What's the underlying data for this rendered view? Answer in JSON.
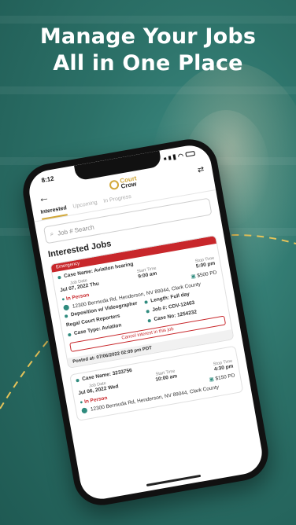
{
  "headline": {
    "line1": "Manage Your Jobs",
    "line2": "All in One Place"
  },
  "phone": {
    "time": "8:12",
    "logo_top": "Court",
    "logo_bottom": "Crow",
    "tabs": [
      {
        "label": "Interested",
        "active": true
      },
      {
        "label": "Upcoming",
        "active": false
      },
      {
        "label": "In Progress",
        "active": false
      }
    ],
    "search_placeholder": "Job # Search",
    "section_title": "Interested Jobs",
    "jobs": [
      {
        "banner": "Emergency",
        "case_name": "Case Name: Aviation hearing",
        "job_date_label": "Job Date",
        "job_date": "Jul 07, 2022 Thu",
        "start_label": "Start Time",
        "start": "9:00 am",
        "stop_label": "Stop Time",
        "stop": "5:00 pm",
        "mode": "In Person",
        "rate": "$500 PD",
        "address": "12300 Bermuda Rd, Henderson, NV 89044, Clark County",
        "deposition": "Deposition w/ Videographer",
        "length": "Length: Full day",
        "agency": "Regal Court Reporters",
        "job_no": "Job #: CDV-12463",
        "case_type": "Case Type: Aviation",
        "case_no": "Case No: 1254232",
        "cancel_label": "Cancel interest in this job",
        "posted": "Posted at: 07/06/2022 02:09 pm PDT"
      },
      {
        "case_name": "Case Name: 3233756",
        "job_date_label": "Job Date",
        "job_date": "Jul 06, 2022 Wed",
        "start_label": "Start Time",
        "start": "10:00 am",
        "stop_label": "Stop Time",
        "stop": "4:30 pm",
        "mode": "In Person",
        "rate": "$150 PD",
        "address": "12300 Bermuda Rd, Henderson, NV 89044, Clark County"
      }
    ]
  },
  "colors": {
    "background": "#2c7168",
    "accent_gold": "#d2a83a",
    "alert_red": "#c8272b",
    "teal": "#2f8b7e"
  }
}
